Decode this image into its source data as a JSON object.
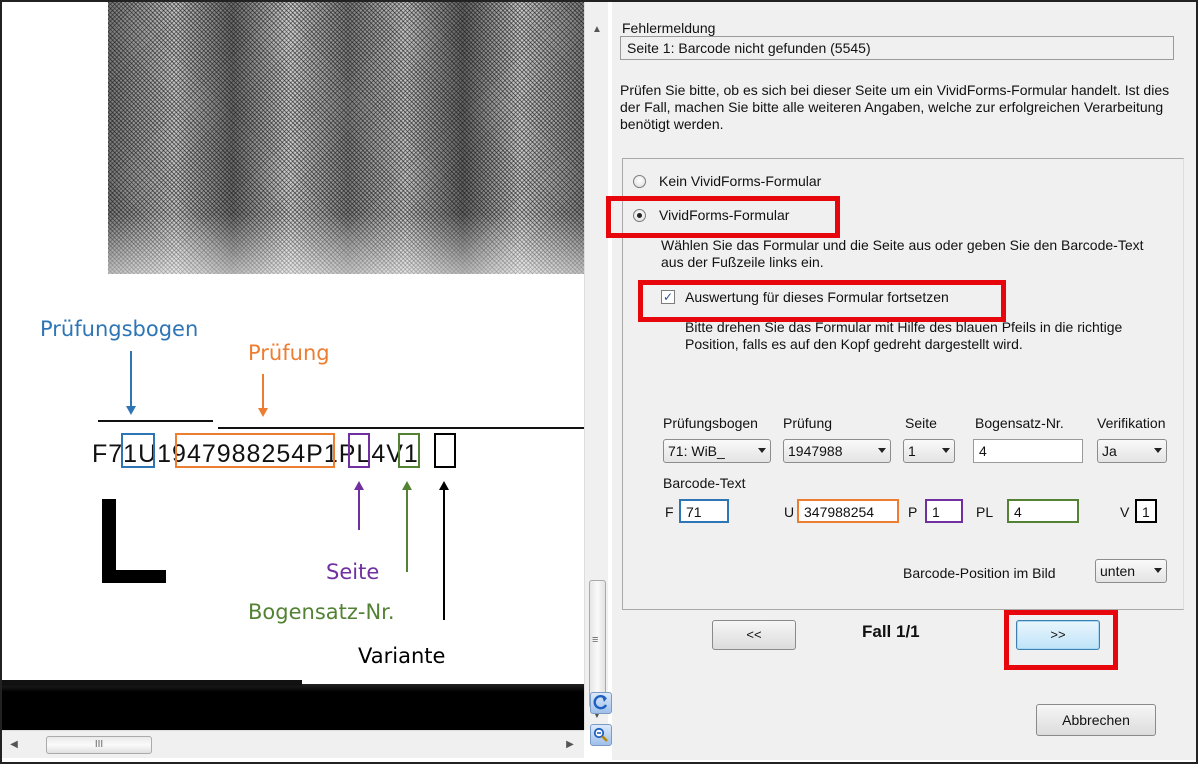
{
  "viewer": {
    "barcode_text": "F71U1947988254P1PL4V1",
    "annotations": {
      "pruefungsbogen": "Prüfungsbogen",
      "pruefung": "Prüfung",
      "seite": "Seite",
      "bogensatz": "Bogensatz-Nr.",
      "variante": "Variante"
    },
    "colors": {
      "blue": "#2e75b6",
      "orange": "#ed7d31",
      "purple": "#7030a0",
      "green": "#548235",
      "black": "#000000",
      "highlight": "#e6060b"
    },
    "hscroll_grip": "III"
  },
  "panel": {
    "error_label": "Fehlermeldung",
    "error_value": "Seite 1: Barcode nicht gefunden (5545)",
    "info_text": "Prüfen Sie bitte, ob es sich bei dieser Seite um ein VividForms-Formular handelt. Ist dies der Fall, machen Sie bitte alle weiteren Angaben, welche zur erfolgreichen Verarbeitung benötigt werden.",
    "radio_not_form": "Kein VividForms-Formular",
    "radio_form": "VividForms-Formular",
    "select_hint": "Wählen Sie das Formular und die Seite aus oder geben Sie den Barcode-Text aus der Fußzeile links ein.",
    "checkbox_continue": "Auswertung für dieses Formular fortsetzen",
    "rotate_hint": "Bitte drehen Sie das Formular mit Hilfe des blauen Pfeils in die richtige Position, falls es auf den Kopf gedreht dargestellt wird.",
    "fields": {
      "pruefungsbogen_label": "Prüfungsbogen",
      "pruefungsbogen_value": "71: WiB_",
      "pruefung_label": "Prüfung",
      "pruefung_value": "1947988",
      "seite_label": "Seite",
      "seite_value": "1",
      "bogensatz_label": "Bogensatz-Nr.",
      "bogensatz_value": "4",
      "verifikation_label": "Verifikation",
      "verifikation_value": "Ja"
    },
    "barcode": {
      "label": "Barcode-Text",
      "f_label": "F",
      "f_value": "71",
      "u_label": "U",
      "u_value": "347988254",
      "p_label": "P",
      "p_value": "1",
      "pl_label": "PL",
      "pl_value": "4",
      "v_label": "V",
      "v_value": "1"
    },
    "position_label": "Barcode-Position im Bild",
    "position_value": "unten",
    "prev_button": "<<",
    "case_label": "Fall 1/1",
    "next_button": ">>",
    "cancel_button": "Abbrechen"
  }
}
